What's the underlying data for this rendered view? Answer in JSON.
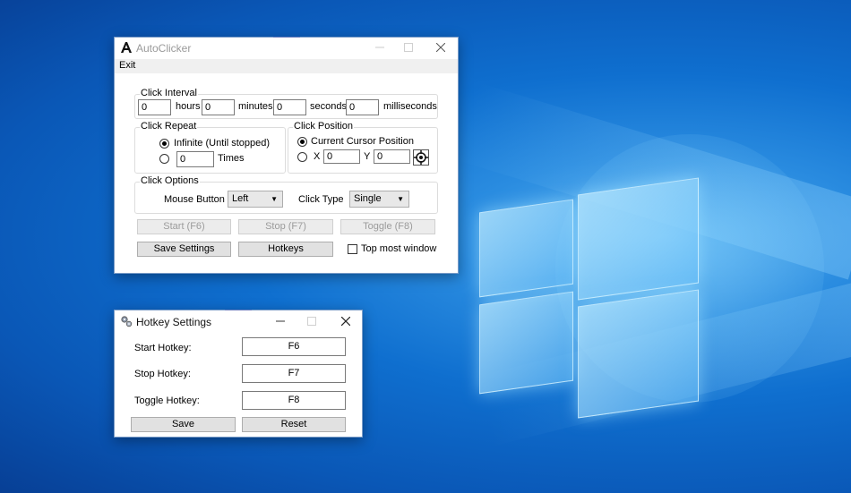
{
  "autoclicker": {
    "title": "AutoClicker",
    "menu": {
      "exit": "Exit"
    },
    "click_interval": {
      "title": "Click Interval",
      "hours_value": "0",
      "hours_label": "hours",
      "minutes_value": "0",
      "minutes_label": "minutes",
      "seconds_value": "0",
      "seconds_label": "seconds",
      "ms_value": "0",
      "ms_label": "milliseconds"
    },
    "click_repeat": {
      "title": "Click Repeat",
      "infinite_label": "Infinite (Until stopped)",
      "times_value": "0",
      "times_label": "Times"
    },
    "click_position": {
      "title": "Click Position",
      "current_label": "Current Cursor Position",
      "x_label": "X",
      "x_value": "0",
      "y_label": "Y",
      "y_value": "0"
    },
    "click_options": {
      "title": "Click Options",
      "mouse_button_label": "Mouse Button",
      "mouse_button_value": "Left",
      "click_type_label": "Click Type",
      "click_type_value": "Single"
    },
    "buttons": {
      "start": "Start (F6)",
      "stop": "Stop (F7)",
      "toggle": "Toggle (F8)",
      "save_settings": "Save Settings",
      "hotkeys": "Hotkeys"
    },
    "top_most_label": "Top most window"
  },
  "hotkeys": {
    "title": "Hotkey Settings",
    "start_label": "Start Hotkey:",
    "start_value": "F6",
    "stop_label": "Stop Hotkey:",
    "stop_value": "F7",
    "toggle_label": "Toggle Hotkey:",
    "toggle_value": "F8",
    "save": "Save",
    "reset": "Reset"
  },
  "icons": [
    "app-icon",
    "gears-icon",
    "minimize-icon",
    "maximize-icon",
    "close-icon",
    "crosshair-icon",
    "chevron-down-icon"
  ],
  "colors": {
    "desktop": "#0a6fd0",
    "window_border": "#7a9cc8",
    "grip": "#9aaad8"
  }
}
